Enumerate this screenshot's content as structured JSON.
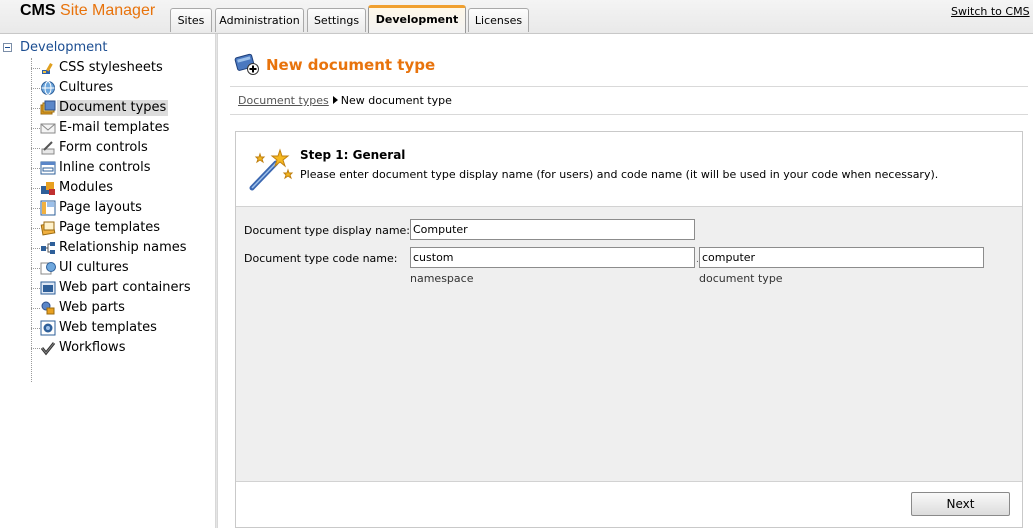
{
  "header": {
    "logo_cms": "CMS",
    "logo_site_manager": "Site Manager",
    "tabs": [
      {
        "label": "Sites"
      },
      {
        "label": "Administration"
      },
      {
        "label": "Settings"
      },
      {
        "label": "Development",
        "active": true
      },
      {
        "label": "Licenses"
      }
    ],
    "switch_link": "Switch to CMS"
  },
  "sidebar": {
    "root_label": "Development",
    "items": [
      {
        "label": "CSS stylesheets",
        "icon": "brush-icon"
      },
      {
        "label": "Cultures",
        "icon": "globe-icon"
      },
      {
        "label": "Document types",
        "icon": "document-stack-icon",
        "selected": true
      },
      {
        "label": "E-mail templates",
        "icon": "envelope-icon"
      },
      {
        "label": "Form controls",
        "icon": "pen-control-icon"
      },
      {
        "label": "Inline controls",
        "icon": "inline-control-icon"
      },
      {
        "label": "Modules",
        "icon": "modules-icon"
      },
      {
        "label": "Page layouts",
        "icon": "layout-icon"
      },
      {
        "label": "Page templates",
        "icon": "page-template-icon"
      },
      {
        "label": "Relationship names",
        "icon": "relationship-icon"
      },
      {
        "label": "UI cultures",
        "icon": "ui-culture-icon"
      },
      {
        "label": "Web part containers",
        "icon": "container-icon"
      },
      {
        "label": "Web parts",
        "icon": "web-parts-icon"
      },
      {
        "label": "Web templates",
        "icon": "web-template-icon"
      },
      {
        "label": "Workflows",
        "icon": "checkmark-icon"
      }
    ]
  },
  "main": {
    "title": "New document type",
    "breadcrumb": {
      "link": "Document types",
      "current": "New document type"
    },
    "wizard": {
      "step_title": "Step 1: General",
      "step_description": "Please enter document type display name (for users) and code name (it will be used in your code when necessary).",
      "display_name_label": "Document type display name:",
      "display_name_value": "Computer",
      "code_name_label": "Document type code name:",
      "namespace_value": "custom",
      "doctype_value": "computer",
      "namespace_hint": "namespace",
      "doctype_hint": "document type",
      "separator": ".",
      "next_label": "Next"
    }
  },
  "colors": {
    "accent": "#e8730c",
    "link": "#1b4d91",
    "panel": "#efefef"
  }
}
